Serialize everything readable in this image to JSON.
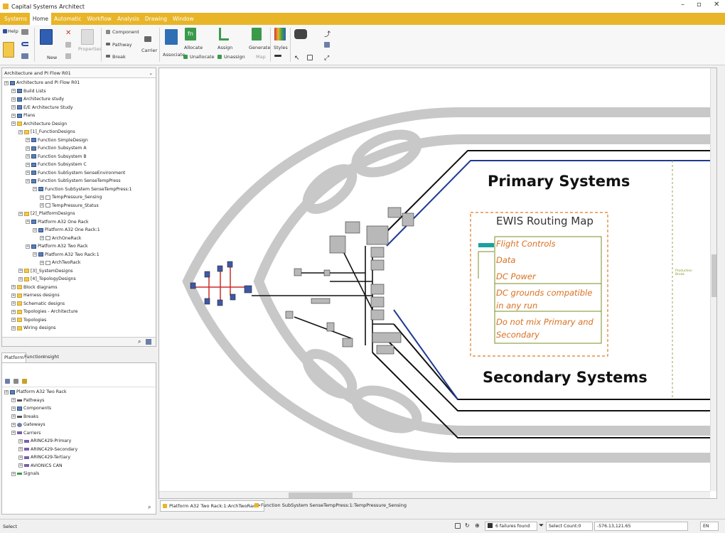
{
  "window": {
    "title": "Capital Systems Architect"
  },
  "menu": [
    "Systems",
    "Home",
    "Automatic",
    "Workflow",
    "Analysis",
    "Drawing",
    "Window"
  ],
  "menu_active": "Home",
  "ribbon": {
    "help": "Help",
    "new": "New",
    "properties": "Properties",
    "component": "Component",
    "pathway": "Pathway",
    "break": "Break",
    "carrier": "Carrier",
    "associate": "Associate",
    "allocate": "Allocate",
    "unallocate": "Unallocate",
    "assign": "Assign",
    "unassign": "Unassign",
    "generate": "Generate",
    "map": "Map",
    "styles": "Styles"
  },
  "top_tree": {
    "header": "Architecture and PI Flow R01",
    "items": [
      {
        "label": "Architecture and PI Flow R01",
        "indent": 0,
        "icon": "doc"
      },
      {
        "label": "Build Lists",
        "indent": 1,
        "icon": "doc"
      },
      {
        "label": "Architecture study",
        "indent": 1,
        "icon": "doc"
      },
      {
        "label": "E/E Architecture Study",
        "indent": 1,
        "icon": "doc"
      },
      {
        "label": "Plans",
        "indent": 1,
        "icon": "doc"
      },
      {
        "label": "Architecture Design",
        "indent": 1,
        "icon": "folder"
      },
      {
        "label": "[1]_FunctionDesigns",
        "indent": 2,
        "icon": "folder"
      },
      {
        "label": "Function SimpleDesign",
        "indent": 3,
        "icon": "doc"
      },
      {
        "label": "Function Subsystem A",
        "indent": 3,
        "icon": "doc"
      },
      {
        "label": "Function Subsystem B",
        "indent": 3,
        "icon": "doc"
      },
      {
        "label": "Function Subsystem C",
        "indent": 3,
        "icon": "doc"
      },
      {
        "label": "Function SubSystem SenseEnvironment",
        "indent": 3,
        "icon": "doc"
      },
      {
        "label": "Function SubSystem SenseTempPress",
        "indent": 3,
        "icon": "doc"
      },
      {
        "label": "Function SubSystem SenseTempPress:1",
        "indent": 4,
        "icon": "doc"
      },
      {
        "label": "TempPressure_Sensing",
        "indent": 5,
        "icon": "page"
      },
      {
        "label": "TempPressure_Status",
        "indent": 5,
        "icon": "page"
      },
      {
        "label": "[2]_PlatformDesigns",
        "indent": 2,
        "icon": "folder"
      },
      {
        "label": "Platform A32 One Rack",
        "indent": 3,
        "icon": "doc"
      },
      {
        "label": "Platform A32 One Rack:1",
        "indent": 4,
        "icon": "doc"
      },
      {
        "label": "ArchOneRack",
        "indent": 5,
        "icon": "page"
      },
      {
        "label": "Platform A32 Two Rack",
        "indent": 3,
        "icon": "doc"
      },
      {
        "label": "Platform A32 Two Rack:1",
        "indent": 4,
        "icon": "doc"
      },
      {
        "label": "ArchTwoRack",
        "indent": 5,
        "icon": "page"
      },
      {
        "label": "[3]_SystemDesigns",
        "indent": 2,
        "icon": "folder"
      },
      {
        "label": "[4]_TopologyDesigns",
        "indent": 2,
        "icon": "folder"
      },
      {
        "label": "Block diagrams",
        "indent": 1,
        "icon": "folder"
      },
      {
        "label": "Harness designs",
        "indent": 1,
        "icon": "folder"
      },
      {
        "label": "Schematic designs",
        "indent": 1,
        "icon": "folder"
      },
      {
        "label": "Topologies - Architecture",
        "indent": 1,
        "icon": "folder"
      },
      {
        "label": "Topologies",
        "indent": 1,
        "icon": "folder"
      },
      {
        "label": "Wiring designs",
        "indent": 1,
        "icon": "folder"
      }
    ]
  },
  "bottom_tabs": [
    "Platform",
    "Function",
    "Insight"
  ],
  "bottom_tree": {
    "items": [
      {
        "label": "Platform A32 Two Rack",
        "indent": 0,
        "icon": "doc"
      },
      {
        "label": "Pathways",
        "indent": 1,
        "icon": "path"
      },
      {
        "label": "Components",
        "indent": 1,
        "icon": "doc"
      },
      {
        "label": "Breaks",
        "indent": 1,
        "icon": "path"
      },
      {
        "label": "Gateways",
        "indent": 1,
        "icon": "gate"
      },
      {
        "label": "Carriers",
        "indent": 1,
        "icon": "carrier"
      },
      {
        "label": "ARINC429-Primary",
        "indent": 2,
        "icon": "carrier"
      },
      {
        "label": "ARINC429-Secondary",
        "indent": 2,
        "icon": "carrier"
      },
      {
        "label": "ARINC429-Tertiary",
        "indent": 2,
        "icon": "carrier"
      },
      {
        "label": "AVIONICS CAN",
        "indent": 2,
        "icon": "carrier"
      },
      {
        "label": "Signals",
        "indent": 1,
        "icon": "signal"
      }
    ]
  },
  "diagram": {
    "primary_label": "Primary Systems",
    "secondary_label": "Secondary Systems",
    "legend_title": "EWIS Routing Map",
    "legend_items": [
      "Flight Controls",
      "Data",
      "DC Power",
      "DC grounds compatible in any run",
      "Do not mix Primary and Secondary"
    ],
    "production_break_label": "Production Break",
    "colors": {
      "outline": "#c8c8c8",
      "primary": "#1f3a93",
      "legend_border": "#e07a20",
      "legend_text": "#d87020",
      "legend_box": "#7a8f20",
      "teal": "#1aa0a0"
    }
  },
  "doc_tabs": [
    "Platform A32 Two Rack:1:ArchTwoRack*",
    "Function SubSystem SenseTempPress:1:TempPressure_Sensing"
  ],
  "status": {
    "mode": "Select",
    "failures": "6 failures found",
    "select_count": "Select Count:0",
    "coords": "-576.13,121.65",
    "lang": "EN"
  }
}
